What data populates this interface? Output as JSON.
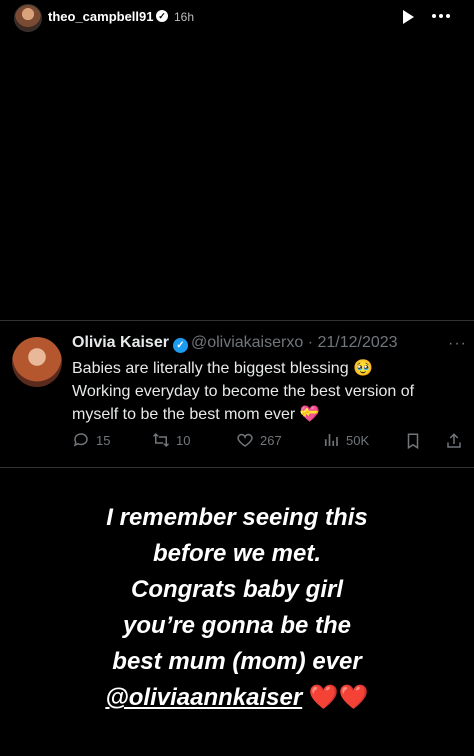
{
  "story": {
    "username": "theo_campbell91",
    "time_ago": "16h",
    "verified_glyph": "✓",
    "icons": {
      "play": "play-icon",
      "more": "more-icon"
    }
  },
  "tweet": {
    "author_name": "Olivia Kaiser",
    "verified_glyph": "✓",
    "handle": "@oliviakaiserxo",
    "separator": "·",
    "date": "21/12/2023",
    "more_glyph": "···",
    "lines": [
      "Babies are literally the biggest blessing 🥹",
      "Working everyday to become the best version of",
      "myself to be the best mom ever 💝"
    ],
    "actions": {
      "replies": "15",
      "retweets": "10",
      "likes": "267",
      "views": "50K"
    },
    "accent_color": "#1d9bf0"
  },
  "caption": {
    "lines": [
      "I remember seeing this",
      "before we met.",
      "Congrats baby girl",
      "you’re gonna be the",
      "best mum (mom) ever"
    ],
    "mention": "@oliviaannkaiser",
    "hearts": "❤️❤️"
  }
}
